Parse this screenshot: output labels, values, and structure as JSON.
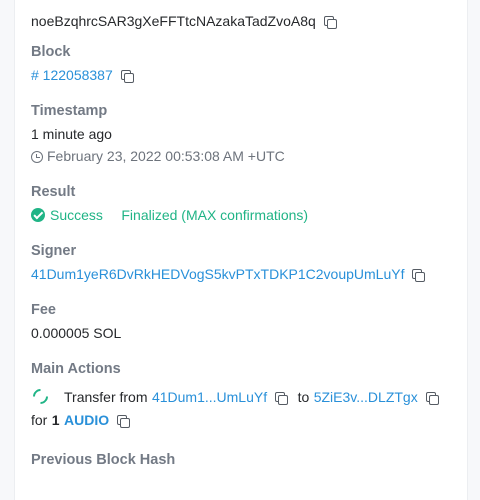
{
  "signature": {
    "top_fragment": "",
    "value": "noeBzqhrcSAR3gXeFFTtcNAzakaTadZvoA8q"
  },
  "block": {
    "label": "Block",
    "value": "# 122058387"
  },
  "timestamp": {
    "label": "Timestamp",
    "relative": "1 minute ago",
    "absolute": "February 23, 2022 00:53:08 AM +UTC"
  },
  "result": {
    "label": "Result",
    "status": "Success",
    "finality": "Finalized (MAX confirmations)",
    "success_color": "#20b486"
  },
  "signer": {
    "label": "Signer",
    "value": "41Dum1yeR6DvRkHEDVogS5kvPTxTDKP1C2voupUmLuYf"
  },
  "fee": {
    "label": "Fee",
    "value": "0.000005 SOL"
  },
  "main_actions": {
    "label": "Main Actions",
    "transfer_from_text": "Transfer from",
    "from_address": "41Dum1...UmLuYf",
    "to_text": "to",
    "to_address": "5ZiE3v...DLZTgx",
    "for_text": "for",
    "amount": "1",
    "token": "AUDIO"
  },
  "previous_block_hash": {
    "label": "Previous Block Hash"
  },
  "colors": {
    "link": "#2990d9",
    "label": "#737a85",
    "text": "#26282b"
  },
  "icons": [
    "copy-icon",
    "clock-icon",
    "check-circle-icon",
    "sync-icon"
  ]
}
